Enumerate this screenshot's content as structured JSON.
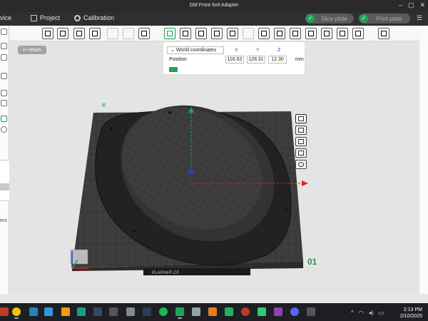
{
  "window": {
    "title": "GM Front 6x9 Adapter"
  },
  "menu": {
    "device_label": "vice",
    "project_label": "Project",
    "calibration_label": "Calibration",
    "slice_plate_label": "Slice plate",
    "print_plate_label": "Print plate"
  },
  "toolbar": {
    "tools": [
      "add-object-icon",
      "arrange-grid-icon",
      "orient-icon",
      "split-icon",
      "copy-icon",
      "paste-icon",
      "layers-icon",
      "move-icon",
      "rotate-icon",
      "scale-icon",
      "lay-on-face-icon",
      "cut-icon",
      "measure-icon",
      "support-paint-icon",
      "seam-paint-icon",
      "text-icon",
      "color-paint-icon",
      "ruler-icon",
      "assembly-icon",
      "boolean-icon",
      "variable-layer-icon"
    ]
  },
  "viewport": {
    "return_label": "return",
    "position_panel": {
      "coordinate_system": "World coordinates",
      "axis_x": "X",
      "axis_y": "Y",
      "axis_z": "Z",
      "position_label": "Position",
      "x_value": "116.52",
      "y_value": "128.31",
      "z_value": "12.30",
      "unit": "mm"
    },
    "plate_label": "PLA/PAHT-CF",
    "plate_number": "01"
  },
  "colors": {
    "accent": "#1fa35a",
    "axis_x": "#e02020",
    "axis_y": "#1aa84a",
    "axis_z": "#2a3acc"
  },
  "taskbar": {
    "time": "2:13 PM",
    "date": "2/10/2025"
  }
}
